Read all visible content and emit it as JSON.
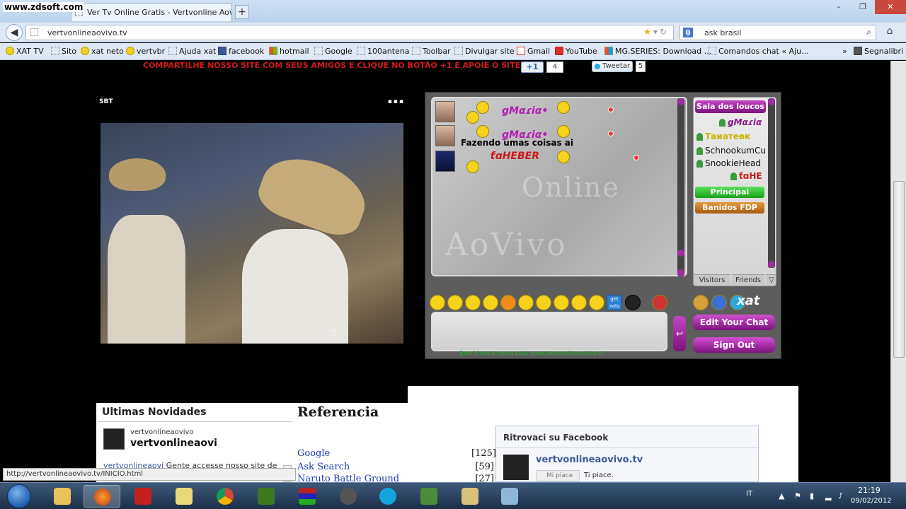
{
  "watermark": "www.zdsoft.com",
  "tab": {
    "title": "Ver Tv Online Gratis - Vertvonline Aovivo ..."
  },
  "window": {
    "minimize": "–",
    "restore": "❐",
    "close": "✕"
  },
  "nav": {
    "url": "vertvonlineaovivo.tv",
    "search_value": "ask brasil",
    "search_engine_letter": "g"
  },
  "bookmarks": [
    {
      "label": "XAT TV",
      "icon": "smiley-icon"
    },
    {
      "label": "Sito",
      "icon": "page-icon"
    },
    {
      "label": "xat neto",
      "icon": "smiley-icon"
    },
    {
      "label": "vertvbr",
      "icon": "smiley-icon"
    },
    {
      "label": "Ajuda xat",
      "icon": "page-icon"
    },
    {
      "label": "facebook",
      "icon": "facebook-icon"
    },
    {
      "label": "hotmail",
      "icon": "windows-icon"
    },
    {
      "label": "Google",
      "icon": "page-icon"
    },
    {
      "label": "100antena",
      "icon": "page-icon"
    },
    {
      "label": "Toolbar",
      "icon": "page-icon"
    },
    {
      "label": "Divulgar site",
      "icon": "page-icon"
    },
    {
      "label": "Gmail",
      "icon": "gmail-icon"
    },
    {
      "label": "YouTube",
      "icon": "youtube-icon"
    },
    {
      "label": "MG.SERIES: Download ...",
      "icon": "grid-icon"
    },
    {
      "label": "Comandos chat « Aju...",
      "icon": "page-icon"
    },
    {
      "label": "»",
      "icon": ""
    },
    {
      "label": "Segnalibri",
      "icon": "bookmarks-icon"
    }
  ],
  "page": {
    "share_text": "COMPARTILHE NOSSO SITE COM SEUS AMIGOS E CLIQUE NO BOTÃO +1 E APOIE O SITE",
    "plus1_label": "+1",
    "plus1_count": "4",
    "tweet_label": "Tweetar",
    "tweet_count": "5"
  },
  "player": {
    "channel": "SBT",
    "controls": "▪▪▪"
  },
  "chat": {
    "watermark_top": "Online",
    "watermark_bottom": "AoVivo",
    "messages": [
      {
        "name": "ǥMαɾiα•",
        "text": ""
      },
      {
        "name": "ǥMαɾiα•",
        "text": "Fazendo umas coisas ai"
      },
      {
        "name": "ƭɑHEBER",
        "text": ""
      }
    ],
    "room": "Sala dos loucos",
    "users": [
      {
        "name": "ǥMαɾiα",
        "style": "mag"
      },
      {
        "name": "Таиатеѳк",
        "style": "gold"
      },
      {
        "name": "SchnookumCu",
        "style": "normal"
      },
      {
        "name": "SnookieHead",
        "style": "normal"
      },
      {
        "name": "ƭɑHE",
        "style": "red"
      }
    ],
    "group_principal": "Principal",
    "group_banidos": "Banidos FDP",
    "tab_visitors": "Visitors",
    "tab_friends": "Friends",
    "logo": "xat",
    "edit_label": "Edit Your Chat",
    "signout_label": "Sign Out",
    "send_icon": "↩",
    "footer_text": "Bem Vindo a nossa sala: www.vertvonlineaovivo.tv"
  },
  "news": {
    "title": "Ultimas Novidades",
    "user_small": "vertvonlineaovivo",
    "user_big": "vertvonlineaovi",
    "post_user": "vertvonlineaovi",
    "post_text": " Gente accesse nosso site de tv grátis sem pagar nada"
  },
  "reference": {
    "title": "Referencia",
    "items": [
      {
        "label": "Google",
        "count": "[125]"
      },
      {
        "label": "Ask Search",
        "count": "[59]"
      },
      {
        "label": "Naruto Battle Ground",
        "count": "[27]"
      }
    ]
  },
  "facebook": {
    "title": "Ritrovaci su Facebook",
    "page_name": "vertvonlineaovivo.tv",
    "like_button": "Mi piace",
    "like_label": "Ti piace."
  },
  "status_url": "http://vertvonlineaovivo.tv/INICIO.html",
  "taskbar": {
    "language": "IT",
    "time": "21:19",
    "date": "09/02/2012"
  }
}
